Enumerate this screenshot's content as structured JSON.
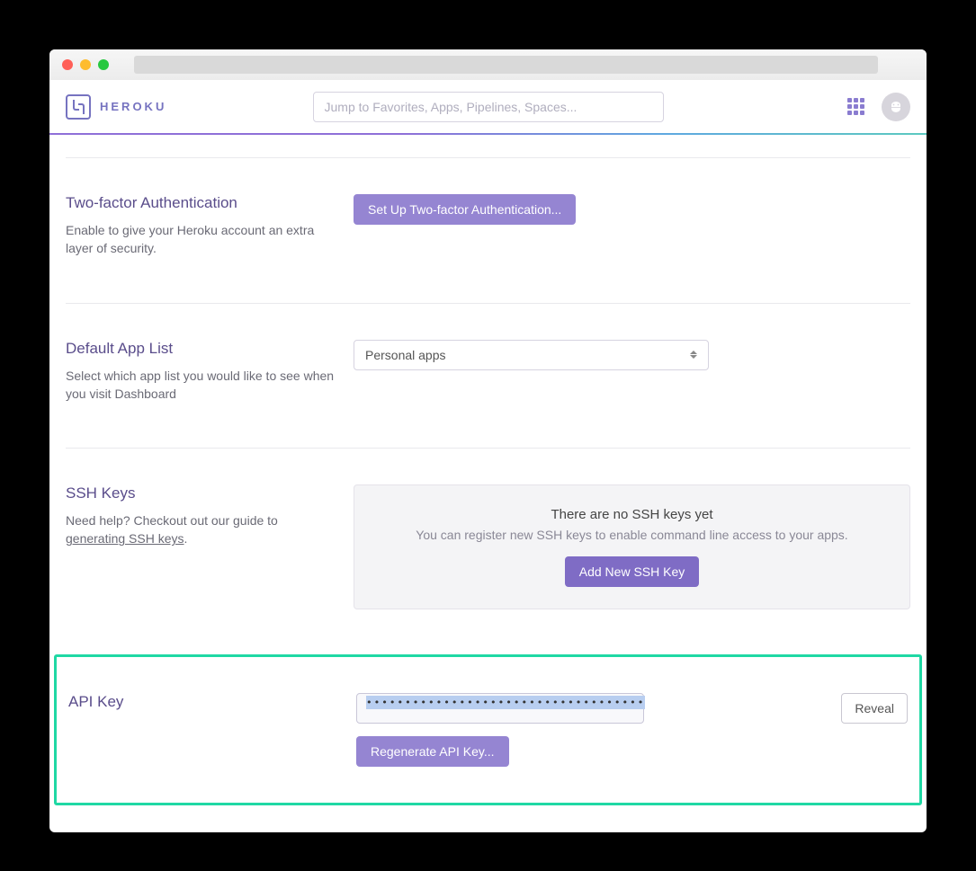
{
  "brand": "HEROKU",
  "search_placeholder": "Jump to Favorites, Apps, Pipelines, Spaces...",
  "sections": {
    "twofa": {
      "title": "Two-factor Authentication",
      "desc": "Enable to give your Heroku account an extra layer of security.",
      "button": "Set Up Two-factor Authentication..."
    },
    "applist": {
      "title": "Default App List",
      "desc": "Select which app list you would like to see when you visit Dashboard",
      "selected": "Personal apps"
    },
    "ssh": {
      "title": "SSH Keys",
      "desc_pre": "Need help? Checkout out our guide to ",
      "desc_link": "generating SSH keys",
      "desc_post": ".",
      "empty_title": "There are no SSH keys yet",
      "empty_sub": "You can register new SSH keys to enable command line access to your apps.",
      "add_button": "Add New SSH Key"
    },
    "api": {
      "title": "API Key",
      "masked": "••••••••••••••••••••••••••••••••••••",
      "reveal": "Reveal",
      "regen": "Regenerate API Key..."
    }
  }
}
